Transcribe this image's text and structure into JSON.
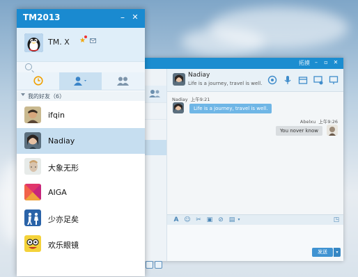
{
  "main_window": {
    "title": "TM2013",
    "minimize_glyph": "–",
    "close_glyph": "✕",
    "profile": {
      "name": "TM. X"
    },
    "group": {
      "label": "我的好友（6）"
    },
    "friends": [
      {
        "name": "ifqin"
      },
      {
        "name": "Nadiay"
      },
      {
        "name": "大象无形"
      },
      {
        "name": "AIGA"
      },
      {
        "name": "少亦足矣"
      },
      {
        "name": "欢乐眼镜"
      }
    ]
  },
  "chat_window": {
    "titlebar_label": "拓摸",
    "contact_name": "Nadiay",
    "contact_signature": "Life is a journey, travel is well.",
    "messages": [
      {
        "sender": "Nadiay",
        "time": "上午9:21",
        "text": "Life is a journey, travel is well."
      },
      {
        "sender": "Abelxu",
        "time": "上午9:26",
        "text": "You nover know"
      }
    ],
    "send_label": "发送",
    "send_dropdown_glyph": "▾"
  },
  "colors": {
    "titlebar": "#1a8ad0",
    "selected_row": "#c6def0",
    "bubble_incoming": "#6fb6e6",
    "bubble_outgoing": "#d9dde0"
  }
}
